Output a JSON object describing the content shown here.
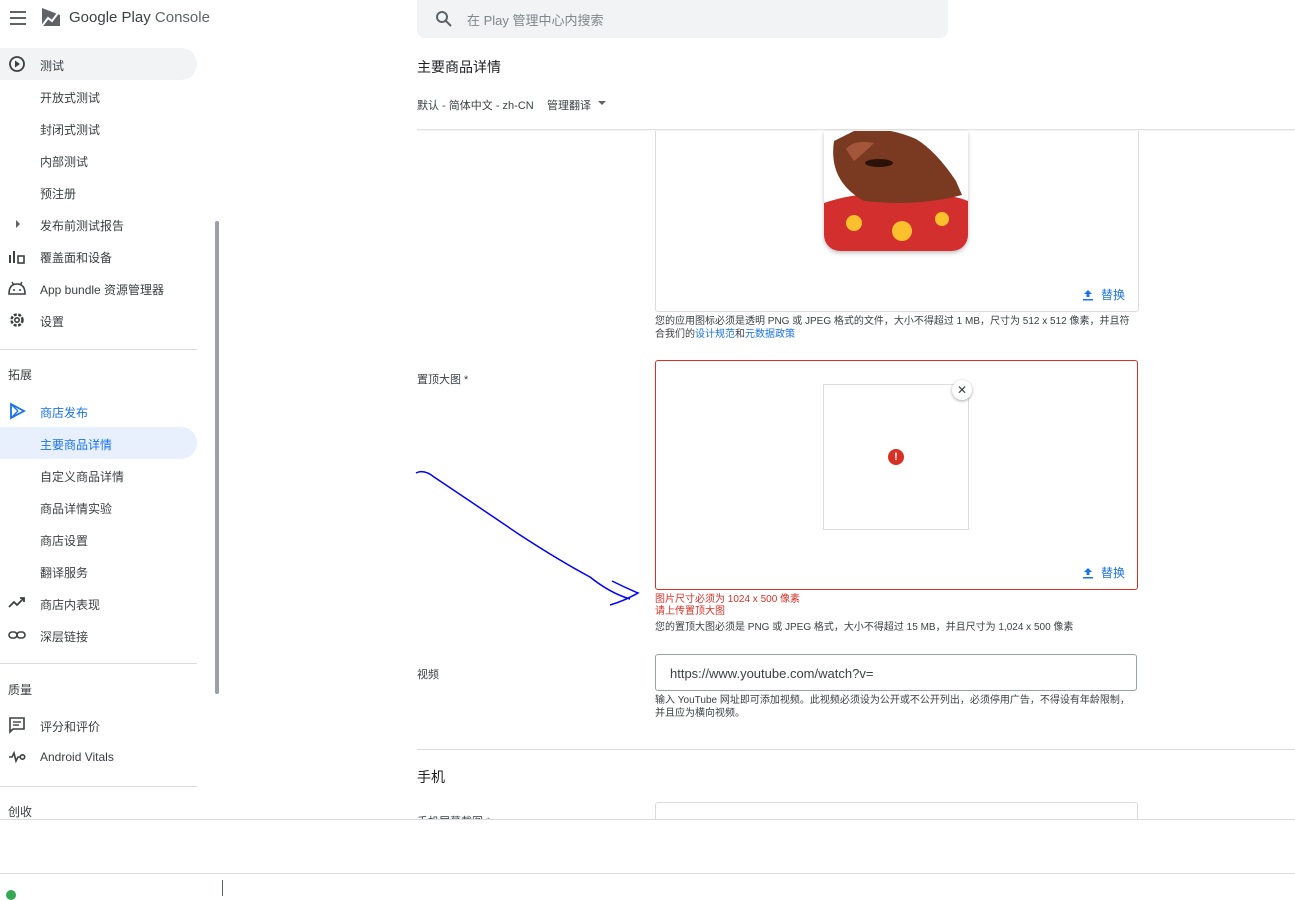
{
  "header": {
    "brand_prefix": "Google Play",
    "brand_suffix": "Console",
    "search_placeholder": "在 Play 管理中心内搜索"
  },
  "sidebar": {
    "items_top": [
      {
        "label": "测试",
        "icon": "play-circle-icon"
      },
      {
        "label": "开放式测试"
      },
      {
        "label": "封闭式测试"
      },
      {
        "label": "内部测试"
      },
      {
        "label": "预注册"
      },
      {
        "label": "发布前测试报告",
        "icon": "caret-right-icon"
      },
      {
        "label": "覆盖面和设备",
        "icon": "bar-chart-icon"
      },
      {
        "label": "App bundle 资源管理器",
        "icon": "android-icon"
      },
      {
        "label": "设置",
        "icon": "gear-icon"
      }
    ],
    "section_grow": "拓展",
    "items_grow": [
      {
        "label": "商店发布",
        "icon": "play-store-icon"
      },
      {
        "label": "主要商品详情"
      },
      {
        "label": "自定义商品详情"
      },
      {
        "label": "商品详情实验"
      },
      {
        "label": "商店设置"
      },
      {
        "label": "翻译服务"
      },
      {
        "label": "商店内表现",
        "icon": "trending-up-icon"
      },
      {
        "label": "深层链接",
        "icon": "link-icon"
      }
    ],
    "section_quality": "质量",
    "items_quality": [
      {
        "label": "评分和评价",
        "icon": "review-icon"
      },
      {
        "label": "Android Vitals",
        "icon": "vitals-icon"
      }
    ],
    "section_monetize": "创收"
  },
  "main": {
    "page_title": "主要商品详情",
    "language": "默认 - 简体中文 - zh-CN",
    "manage_translations": "管理翻译",
    "app_icon": {
      "replace_label": "替换",
      "helper_prefix": "您的应用图标必须是透明 PNG 或 JPEG 格式的文件，大小不得超过 1 MB，尺寸为 512 x 512 像素，并且符合我们的",
      "helper_link1": "设计规范",
      "helper_mid": "和",
      "helper_link2": "元数据政策"
    },
    "feature_graphic": {
      "label": "置顶大图 *",
      "replace_label": "替换",
      "error_size": "图片尺寸必须为 1024 x 500 像素",
      "error_upload": "请上传置顶大图",
      "helper": "您的置顶大图必须是 PNG 或 JPEG 格式，大小不得超过 15 MB，并且尺寸为 1,024 x 500 像素"
    },
    "video": {
      "label": "视频",
      "value": "https://www.youtube.com/watch?v=",
      "helper": "输入 YouTube 网址即可添加视频。此视频必须设为公开或不公开列出，必须停用广告，不得设有年龄限制，并且应为横向视频。"
    },
    "phone": {
      "section_title": "手机",
      "screenshots_label": "手机屏幕截图 *"
    }
  },
  "colors": {
    "accent": "#1a73e8",
    "error": "#d93025",
    "annotation": "#0000ff"
  }
}
